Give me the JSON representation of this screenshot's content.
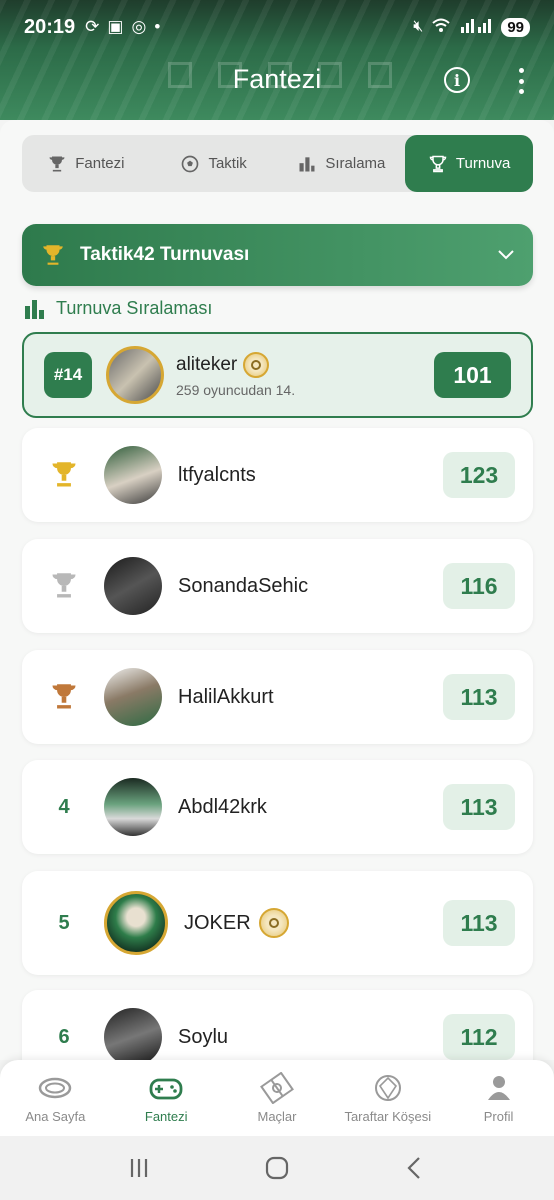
{
  "status_bar": {
    "time": "20:19",
    "battery": "99"
  },
  "header": {
    "title": "Fantezi"
  },
  "tabs": [
    {
      "label": "Fantezi",
      "icon": "trophy-icon"
    },
    {
      "label": "Taktik",
      "icon": "soccer-ball-icon"
    },
    {
      "label": "Sıralama",
      "icon": "bar-chart-icon"
    },
    {
      "label": "Turnuva",
      "icon": "trophy-icon",
      "active": true
    }
  ],
  "tournament": {
    "name": "Taktik42 Turnuvası"
  },
  "section_title": "Turnuva Sıralaması",
  "my_rank": {
    "rank": "#14",
    "name": "aliteker",
    "subtitle": "259 oyuncudan 14.",
    "score": "101"
  },
  "leaderboard": [
    {
      "rank": "1",
      "medal": "gold",
      "name": "ltfyalcnts",
      "score": "123"
    },
    {
      "rank": "2",
      "medal": "silver",
      "name": "SonandaSehic",
      "score": "116"
    },
    {
      "rank": "3",
      "medal": "bronze",
      "name": "HalilAkkurt",
      "score": "113"
    },
    {
      "rank": "4",
      "name": "Abdl42krk",
      "score": "113"
    },
    {
      "rank": "5",
      "name": "JOKER",
      "score": "113",
      "badge": true
    },
    {
      "rank": "6",
      "name": "Soylu",
      "score": "112"
    }
  ],
  "bottom_nav": [
    {
      "label": "Ana Sayfa",
      "icon": "stadium-icon"
    },
    {
      "label": "Fantezi",
      "icon": "gamepad-icon",
      "active": true
    },
    {
      "label": "Maçlar",
      "icon": "pitch-icon"
    },
    {
      "label": "Taraftar Köşesi",
      "icon": "crest-icon"
    },
    {
      "label": "Profil",
      "icon": "person-icon"
    }
  ],
  "colors": {
    "primary": "#2f7d4e",
    "gold": "#e3b52a",
    "silver": "#b8b8b8",
    "bronze": "#c0783a"
  }
}
